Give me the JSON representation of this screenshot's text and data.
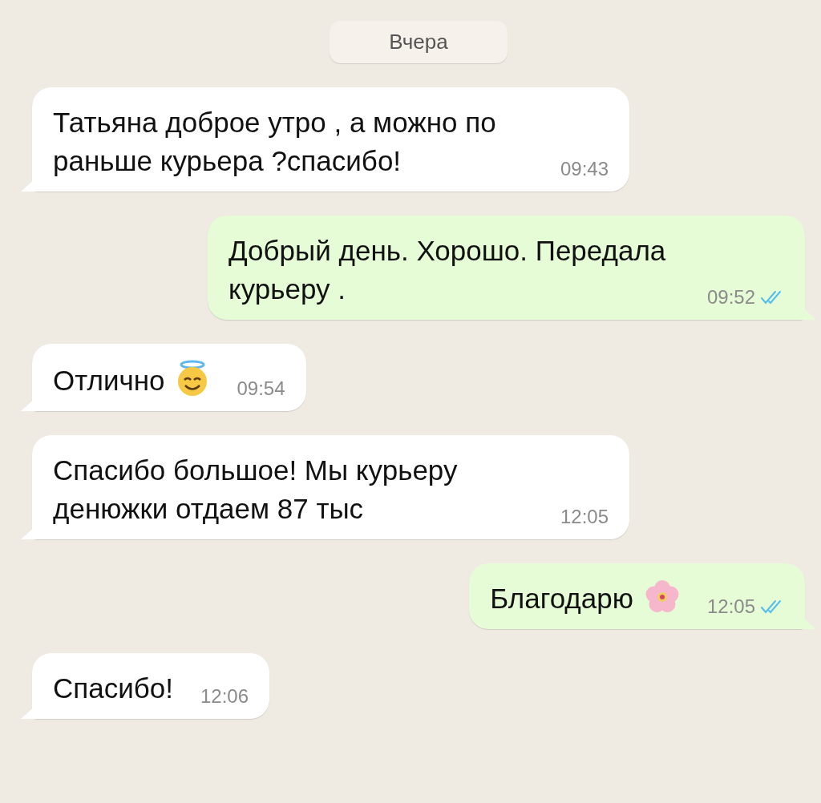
{
  "date_label": "Вчера",
  "messages": [
    {
      "kind": "incoming",
      "text": "Татьяна доброе утро , а можно по раньше курьера ?спасибо!",
      "time": "09:43"
    },
    {
      "kind": "outgoing",
      "text": "Добрый день. Хорошо. Передала курьеру .",
      "time": "09:52",
      "read": true
    },
    {
      "kind": "incoming",
      "text": "Отлично",
      "emoji": {
        "kind": "halo"
      },
      "time": "09:54"
    },
    {
      "kind": "incoming",
      "text": "Спасибо большое! Мы курьеру денюжки отдаем 87 тыс",
      "time": "12:05"
    },
    {
      "kind": "outgoing",
      "text": "Благодарю",
      "emoji": {
        "kind": "flower"
      },
      "time": "12:05",
      "read": true
    },
    {
      "kind": "incoming",
      "text": "Спасибо!",
      "time": "12:06"
    }
  ]
}
